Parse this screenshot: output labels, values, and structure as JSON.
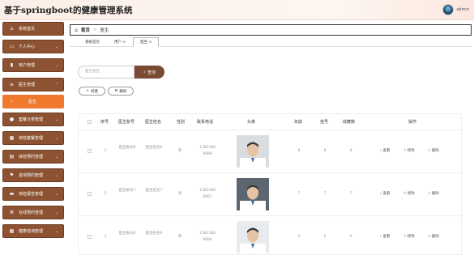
{
  "app": {
    "title": "基于springboot的健康管理系统",
    "user": "admin"
  },
  "sidebar": {
    "items": [
      {
        "label": "系统首页",
        "icon": "home-icon",
        "glyph": "⌂",
        "chevron": false
      },
      {
        "label": "个人中心",
        "icon": "monitor-icon",
        "glyph": "▭",
        "chevron": true
      },
      {
        "label": "用户管理",
        "icon": "user-icon",
        "glyph": "▮",
        "chevron": true
      },
      {
        "label": "医生管理",
        "icon": "menu-icon",
        "glyph": "≡",
        "chevron": true,
        "expanded": true
      },
      {
        "label": "医生",
        "icon": "arrow-icon",
        "glyph": "›",
        "chevron": false,
        "active": true
      },
      {
        "label": "套餐分类管理",
        "icon": "bulb-icon",
        "glyph": "●",
        "chevron": true
      },
      {
        "label": "体检套餐管理",
        "icon": "grid-icon",
        "glyph": "▦",
        "chevron": true
      },
      {
        "label": "体检预约管理",
        "icon": "doc-icon",
        "glyph": "▤",
        "chevron": true
      },
      {
        "label": "咨询预约管理",
        "icon": "flag-icon",
        "glyph": "⚑",
        "chevron": true
      },
      {
        "label": "体检报告管理",
        "icon": "chat-icon",
        "glyph": "▬",
        "chevron": true
      },
      {
        "label": "在线预约管理",
        "icon": "list-icon",
        "glyph": "≣",
        "chevron": true
      },
      {
        "label": "健康咨询管理",
        "icon": "grid2-icon",
        "glyph": "▦",
        "chevron": true
      }
    ]
  },
  "breadcrumb": {
    "home": "首页",
    "current": "医生"
  },
  "tabs": [
    "系统首页",
    "用户 ×",
    "医生 ×"
  ],
  "search": {
    "placeholder": "医生姓名",
    "button": "查询"
  },
  "toolbar": {
    "create": "创建",
    "delete": "删除"
  },
  "table": {
    "headers": [
      "序号",
      "医生账号",
      "医生姓名",
      "性别",
      "联系电话",
      "头像",
      "年龄",
      "挂号",
      "收藏数",
      "操作"
    ],
    "rows": [
      {
        "no": "1",
        "account": "医生账号8",
        "name": "医生姓名8",
        "gender": "男",
        "phone": "13823888888",
        "age": "8",
        "reg": "8",
        "fav": "8"
      },
      {
        "no": "2",
        "account": "医生账号7",
        "name": "医生姓名7",
        "gender": "男",
        "phone": "13823888887",
        "age": "7",
        "reg": "7",
        "fav": "7"
      },
      {
        "no": "3",
        "account": "医生账号6",
        "name": "医生姓名6",
        "gender": "男",
        "phone": "13823888886",
        "age": "6",
        "reg": "6",
        "fav": "6"
      }
    ],
    "actions": {
      "view": "查看",
      "edit": "修改",
      "delete": "删除"
    }
  },
  "colors": {
    "sidebar_bg": "#8c5232",
    "sidebar_active": "#ef7a2e",
    "search_btn": "#7a4a32"
  }
}
